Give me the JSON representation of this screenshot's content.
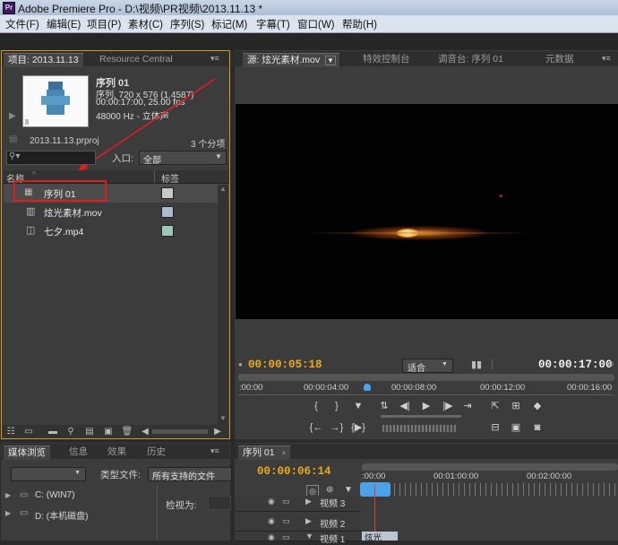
{
  "window": {
    "title": "Adobe Premiere Pro - D:\\视频\\PR视频\\2013.11.13 *",
    "app_icon": "Pr"
  },
  "menu": [
    "文件(F)",
    "编辑(E)",
    "项目(P)",
    "素材(C)",
    "序列(S)",
    "标记(M)",
    "字幕(T)",
    "窗口(W)",
    "帮助(H)"
  ],
  "project_panel": {
    "tabs": [
      "项目: 2013.11.13",
      "Resource Central"
    ],
    "selected_clip": {
      "name": "序列 01",
      "type": "序列, 720 x 576 (1.4587)",
      "duration": "00:00:17:00, 25.00 fps",
      "audio": "48000 Hz - 立体声"
    },
    "project_file": "2013.11.13.prproj",
    "item_count": "3 个分项",
    "search_icon": "search-icon",
    "entry_label": "入口:",
    "entry_value": "全部",
    "columns": {
      "name": "名称",
      "label": "标签"
    },
    "items": [
      {
        "name": "序列 01",
        "icon": "sequence-icon",
        "color": "#c8c8c8"
      },
      {
        "name": "炫光素材.mov",
        "icon": "film-icon",
        "color": "#a9bccc"
      },
      {
        "name": "七夕.mp4",
        "icon": "film-audio-icon",
        "color": "#9dc7b9"
      }
    ],
    "highlight_color": "#e01d1d"
  },
  "source_panel": {
    "tabs": [
      "源: 炫光素材.mov",
      "特效控制台",
      "调音台: 序列 01",
      "元数据"
    ],
    "timecode_current": "00:00:05:18",
    "fit_label": "适合",
    "timecode_duration": "00:00:17:00",
    "ruler": [
      ":00:00",
      "00:00:04:00",
      "00:00:08:00",
      "00:00:12:00",
      "00:00:16:00"
    ],
    "playhead_fraction": 0.34
  },
  "media_panel": {
    "tabs": [
      "媒体浏览",
      "信息",
      "效果",
      "历史"
    ],
    "file_type_label": "类型文件:",
    "file_type_value": "所有支持的文件",
    "view_as_label": "检视为:",
    "drives": [
      "C: (WIN7)",
      "D: (本机磁盘)"
    ]
  },
  "timeline_panel": {
    "tab": "序列 01",
    "timecode": "00:00:06:14",
    "ruler": [
      ":00:00",
      "00:01:00:00",
      "00:02:00:00"
    ],
    "tracks": [
      "视频 3",
      "视频 2",
      "视频 1"
    ],
    "clip_label": "炫光"
  },
  "colors": {
    "timecode": "#f0a91c",
    "panel_border": "#d39b1d",
    "accent_blue": "#4aa3e8"
  }
}
